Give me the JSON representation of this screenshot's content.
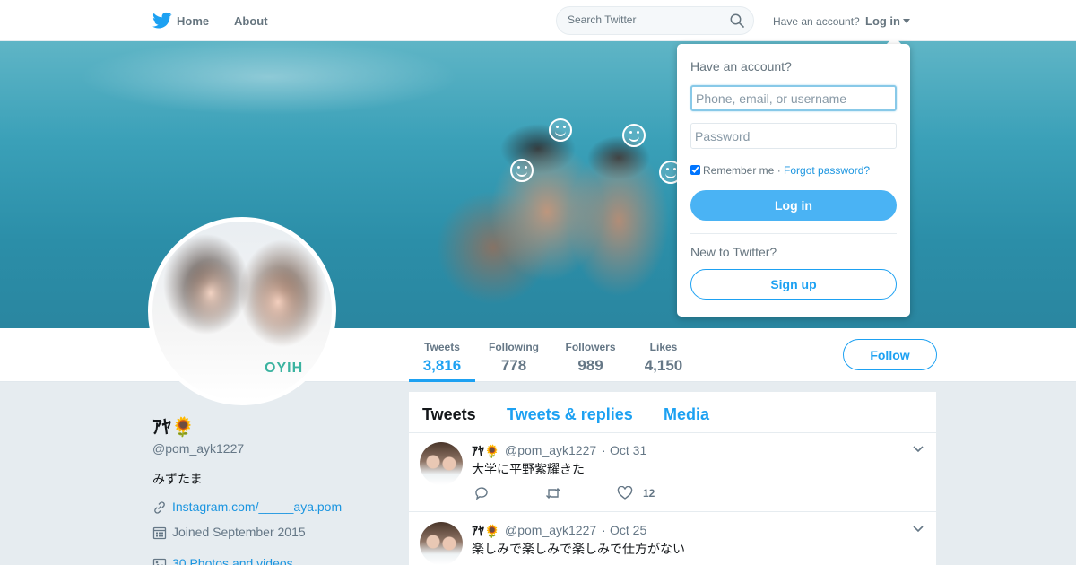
{
  "nav": {
    "home": "Home",
    "about": "About",
    "search_placeholder": "Search Twitter",
    "have_account": "Have an account?",
    "login": "Log in"
  },
  "login_dropdown": {
    "title": "Have an account?",
    "username_placeholder": "Phone, email, or username",
    "password_placeholder": "Password",
    "remember": "Remember me",
    "separator": " · ",
    "forgot": "Forgot password?",
    "login_button": "Log in",
    "new_to_twitter": "New to Twitter?",
    "signup_button": "Sign up"
  },
  "stats": [
    {
      "label": "Tweets",
      "value": "3,816"
    },
    {
      "label": "Following",
      "value": "778"
    },
    {
      "label": "Followers",
      "value": "989"
    },
    {
      "label": "Likes",
      "value": "4,150"
    }
  ],
  "follow_button": "Follow",
  "profile": {
    "name": "ｱﾔ🌻",
    "handle": "@pom_ayk1227",
    "bio": "みずたま",
    "website": "Instagram.com/_____aya.pom",
    "joined": "Joined September 2015",
    "media": "30 Photos and videos",
    "avatar_shirt_text": "OYIH"
  },
  "timeline": {
    "tabs": [
      "Tweets",
      "Tweets & replies",
      "Media"
    ],
    "tweets": [
      {
        "name": "ｱﾔ🌻",
        "handle": "@pom_ayk1227",
        "dot": "·",
        "date": "Oct 31",
        "text": "大学に平野紫耀きた",
        "likes": "12"
      },
      {
        "name": "ｱﾔ🌻",
        "handle": "@pom_ayk1227",
        "dot": "·",
        "date": "Oct 25",
        "text": "楽しみで楽しみで楽しみで仕方がない",
        "likes": ""
      }
    ]
  },
  "colors": {
    "accent": "#1da1f2",
    "button": "#4ab3f4",
    "secondary_text": "#657786",
    "background": "#e6ecf0"
  },
  "icons": [
    "twitter-bird-icon",
    "search-icon",
    "caret-down-icon",
    "link-icon",
    "calendar-icon",
    "photos-icon",
    "reply-icon",
    "retweet-icon",
    "heart-icon",
    "chevron-down-icon",
    "smiley-face-icon"
  ]
}
